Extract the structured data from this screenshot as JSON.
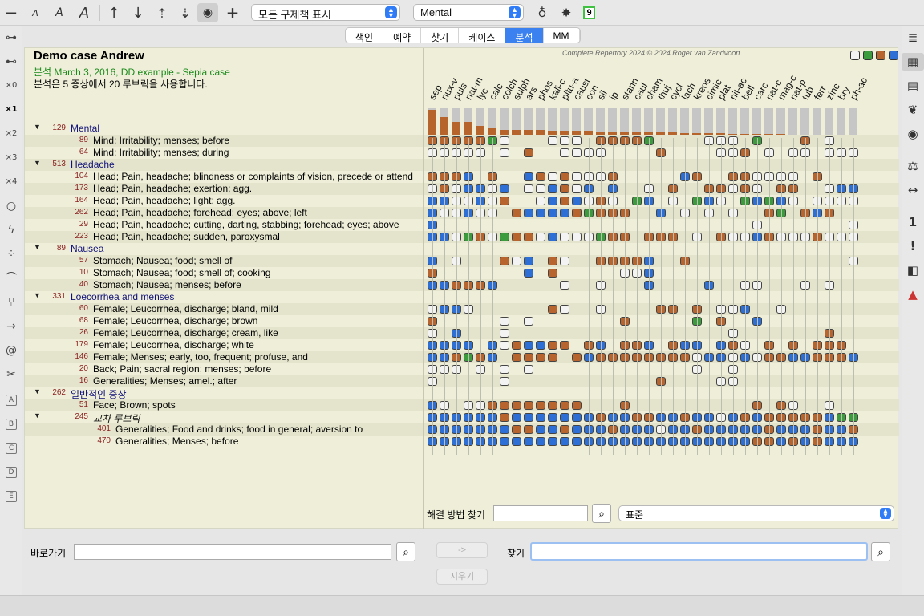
{
  "toolbar": {
    "icons": [
      "zoom-out-icon",
      "font-small-icon",
      "font-medium-icon",
      "font-large-icon",
      "arrow-up-icon",
      "arrow-down-icon",
      "arrow-up-dotted-icon",
      "arrow-down-dotted-icon",
      "eye-icon",
      "plus-icon",
      "lightbulb-icon",
      "magic-wand-icon"
    ],
    "view_select": "모든 구제책 표시",
    "chapter_select": "Mental",
    "badge": "9"
  },
  "tabs": [
    {
      "label": "색인",
      "active": false
    },
    {
      "label": "예약",
      "active": false
    },
    {
      "label": "찾기",
      "active": false
    },
    {
      "label": "케이스",
      "active": false
    },
    {
      "label": "분석",
      "active": true
    },
    {
      "label": "MM",
      "active": false
    }
  ],
  "left_toolbar": [
    "link-icon",
    "unlink-icon",
    "×0",
    "×1",
    "×2",
    "×3",
    "×4",
    "circle-icon",
    "lightning-icon",
    "dots-icon",
    "arc-icon",
    "fork-icon",
    "arrow-right-icon",
    "spiral-icon",
    "cross-icon",
    "A",
    "B",
    "C",
    "D",
    "E"
  ],
  "right_toolbar": [
    "list-icon",
    "grid-icon",
    "table-icon",
    "leaf-icon",
    "eye-icon",
    "scale-icon",
    "width-icon",
    "1",
    "!",
    "gradient-icon",
    "stack-icon"
  ],
  "analysis": {
    "case_title": "Demo case Andrew",
    "case_subtitle": "분석 March 3, 2016, DD example - Sepia case",
    "case_info": "분석은 5 증상에서 20 루브릭을 사용합니다.",
    "copyright": "Complete Repertory 2024 © 2024 Roger van Zandvoort",
    "legend_colors": [
      "#f3f3f3",
      "#3c9b3c",
      "#b8642e",
      "#2d6fd4"
    ]
  },
  "rows": [
    {
      "type": "chapter",
      "count": "129",
      "label": "Mental"
    },
    {
      "type": "rubric",
      "count": "89",
      "label": "Mind; Irritability; menses; before",
      "cells": "ooooogw...www.oooog....www.g...o.w...w..."
    },
    {
      "type": "rubric",
      "count": "64",
      "label": "Mind; Irritability; menses; during",
      "cells": "wwwww.w.o..wwww....o....wwo.w.ww.www..."
    },
    {
      "type": "chapter",
      "count": "513",
      "label": "Headache"
    },
    {
      "type": "rubric",
      "count": "104",
      "label": "Head; Pain, headache; blindness or complaints of vision, precede or attend",
      "cells": "ooob.o..bowowwwo.....bo..oowwww.o....."
    },
    {
      "type": "rubric",
      "count": "173",
      "label": "Head; Pain, headache; exertion; agg.",
      "cells": "wowbbwb.wwbowb.b..w.o..oowow.oo..wbb.."
    },
    {
      "type": "rubric",
      "count": "164",
      "label": "Head; Pain, headache; light; agg.",
      "cells": "bbwwbwo..wbobwow.gb.w.gbw.gbgbw.wwwwo.."
    },
    {
      "type": "rubric",
      "count": "262",
      "label": "Head; Pain, headache; forehead; eyes; above; left",
      "cells": "bwwbww.obbbbogooo..b.w.w.w..og.obo..."
    },
    {
      "type": "rubric",
      "count": "29",
      "label": "Head; Pain, headache; cutting, darting, stabbing; forehead; eyes; above",
      "cells": "b..........................w.......ww.o.."
    },
    {
      "type": "rubric",
      "count": "223",
      "label": "Head; Pain, headache; sudden, paroxysmal",
      "cells": "bbwgowgoowbwwwgoo.ooo.w.owwbowwwowwwwg"
    },
    {
      "type": "chapter",
      "count": "89",
      "label": "Nausea"
    },
    {
      "type": "rubric",
      "count": "57",
      "label": "Stomach; Nausea; food; smell of",
      "cells": "b.w...owb.ow..oooob..o.............w....w"
    },
    {
      "type": "rubric",
      "count": "10",
      "label": "Stomach; Nausea; food; smell of; cooking",
      "cells": "o.......b.o.....wwb......................."
    },
    {
      "type": "rubric",
      "count": "40",
      "label": "Stomach; Nausea; menses; before",
      "cells": "bbooob.....w..w...b....b..ww...w.w.........."
    },
    {
      "type": "chapter",
      "count": "331",
      "label": "Loecorrhea and menses"
    },
    {
      "type": "rubric",
      "count": "60",
      "label": "Female; Leucorrhea, discharge; bland, mild",
      "cells": "wbbw......ow..w....oo.o.wwb..w.........ow"
    },
    {
      "type": "rubric",
      "count": "68",
      "label": "Female; Leucorrhea, discharge; brown",
      "cells": "o.....w.w.......o.....g.o..b.........w..."
    },
    {
      "type": "rubric",
      "count": "26",
      "label": "Female; Leucorrhea, discharge; cream, like",
      "cells": "w.b...w..................w.......o........"
    },
    {
      "type": "rubric",
      "count": "179",
      "label": "Female; Leucorrhea, discharge; white",
      "cells": "bbbb.bwobboo.ob.oob.obb.bow.o.o.ooo....."
    },
    {
      "type": "rubric",
      "count": "146",
      "label": "Female; Menses; early, too, frequent; profuse, and",
      "cells": "bbogob.oooo.oboooooooowbbwbwoobbooobo.."
    },
    {
      "type": "rubric",
      "count": "20",
      "label": "Back; Pain; sacral region; menses; before",
      "cells": "www.w.w.w.............w..w..................."
    },
    {
      "type": "rubric",
      "count": "16",
      "label": "Generalities; Menses; amel.; after",
      "cells": "w.....w............o....ww..............."
    },
    {
      "type": "chapter",
      "count": "262",
      "label": "일반적인 증상"
    },
    {
      "type": "rubric",
      "count": "51",
      "label": "Face; Brown; spots",
      "cells": "bw.wwoooooooo...o..........o.ow..w..........."
    },
    {
      "type": "group",
      "count": "245",
      "label": "교차 루브릭",
      "cells": "bbbbbbobbbbbbbobboobbobbwbobooooobggoo"
    },
    {
      "type": "sub",
      "count": "401",
      "label": "Generalities; Food and drinks; food in general; aversion to",
      "cells": "bbbbbbboobbobbbobbbwbbobbbbbobbbobboboo"
    },
    {
      "type": "sub",
      "count": "470",
      "label": "Generalities; Menses; before",
      "cells": "bbbbbbbbbbbbbbbbbbbbbbbbbbboobobobbbbboo"
    }
  ],
  "remedies": [
    {
      "name": "sep",
      "bar": 0.95
    },
    {
      "name": "nux-v",
      "bar": 0.7
    },
    {
      "name": "puls",
      "bar": 0.55
    },
    {
      "name": "nat-m",
      "bar": 0.55
    },
    {
      "name": "lyc",
      "bar": 0.42
    },
    {
      "name": "calc",
      "bar": 0.35
    },
    {
      "name": "colch",
      "bar": 0.3
    },
    {
      "name": "sulph",
      "bar": 0.3
    },
    {
      "name": "ars",
      "bar": 0.3
    },
    {
      "name": "phos",
      "bar": 0.28
    },
    {
      "name": "kali-c",
      "bar": 0.25
    },
    {
      "name": "pitu-a",
      "bar": 0.25
    },
    {
      "name": "caust",
      "bar": 0.25
    },
    {
      "name": "con",
      "bar": 0.25
    },
    {
      "name": "sil",
      "bar": 0.22
    },
    {
      "name": "ip",
      "bar": 0.2
    },
    {
      "name": "stann",
      "bar": 0.2
    },
    {
      "name": "caul",
      "bar": 0.2
    },
    {
      "name": "cham",
      "bar": 0.2
    },
    {
      "name": "thuj",
      "bar": 0.2
    },
    {
      "name": "cycl",
      "bar": 0.2
    },
    {
      "name": "lach",
      "bar": 0.18
    },
    {
      "name": "kreos",
      "bar": 0.18
    },
    {
      "name": "cimic",
      "bar": 0.18
    },
    {
      "name": "plat",
      "bar": 0.18
    },
    {
      "name": "nit-ac",
      "bar": 0.16
    },
    {
      "name": "bell",
      "bar": 0.16
    },
    {
      "name": "carc",
      "bar": 0.16
    },
    {
      "name": "nat-c",
      "bar": 0.15
    },
    {
      "name": "mag-c",
      "bar": 0.15
    },
    {
      "name": "nat-p",
      "bar": 0.14
    },
    {
      "name": "tub",
      "bar": 0.14
    },
    {
      "name": "ferr",
      "bar": 0.14
    },
    {
      "name": "zinc",
      "bar": 0.12
    },
    {
      "name": "bry",
      "bar": 0.12
    },
    {
      "name": "ph-ac",
      "bar": 0.12
    }
  ],
  "remedy_search": {
    "label": "해결 방법 찾기",
    "value": "",
    "select": "표준"
  },
  "bottom": {
    "goto_label": "바로가기",
    "goto_value": "",
    "arrow_button": "->",
    "clear_button": "지우기",
    "find_label": "찾기",
    "find_value": ""
  }
}
